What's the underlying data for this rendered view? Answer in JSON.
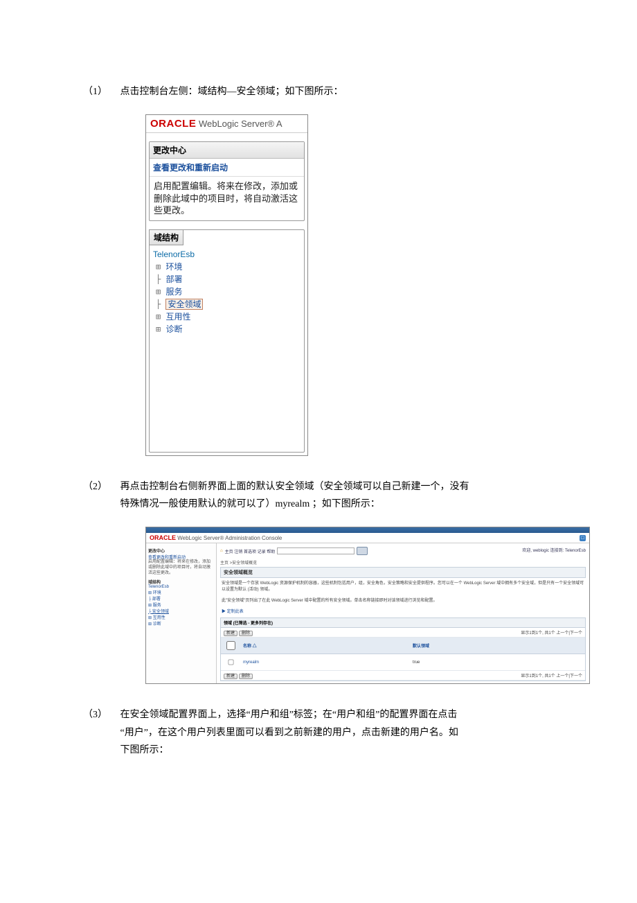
{
  "step1": {
    "num": "（1）",
    "text": "点击控制台左侧：域结构—安全领域；如下图所示："
  },
  "step2": {
    "num": "（2）",
    "line1": "再点击控制台右侧新界面上面的默认安全领域（安全领域可以自己新建一个，没有",
    "line2": "特殊情况一般使用默认的就可以了）myrealm ；如下图所示："
  },
  "step3": {
    "num": "（3）",
    "line1": "在安全领域配置界面上，选择“用户和组”标签；在“用户和组”的配置界面在点击",
    "line2": "“用户”，在这个用户列表里面可以看到之前新建的用户，点击新建的用户名。如",
    "line3": "下图所示："
  },
  "shot1": {
    "logo_oracle": "ORACLE",
    "logo_rest": " WebLogic Server® A",
    "change_center": "更改中心",
    "view_changes": "查看更改和重新启动",
    "config_edit_msg": "启用配置编辑。将来在修改，添加或删除此域中的项目时，将自动激活这些更改。",
    "domain_struct": "域结构",
    "tree": {
      "root": "TelenorEsb",
      "n1": "环境",
      "n2": "部署",
      "n3": "服务",
      "n4": "安全领域",
      "n5": "互用性",
      "n6": "诊断"
    }
  },
  "shot2": {
    "logo_oracle": "ORACLE",
    "logo_rest": " WebLogic Server® Administration Console",
    "side": {
      "change_center": "更改中心",
      "view_changes": "查看更改和重新启动",
      "config_msg": "启用配置编辑：将来在修改，添加或删除此域中的项目时，将自动激活这些更改。",
      "domain_struct": "域结构",
      "root": "TelenorEsb",
      "n1": "环境",
      "n2": "部署",
      "n3": "服务",
      "n4": "安全领域",
      "n5": "互用性",
      "n6": "诊断"
    },
    "crumbs_left": "主页 注销 首选项 记录 帮助",
    "crumbs_right": "欢迎, weblogic   连接到: TelenorEsb",
    "breadcrumb2": "主页 >安全领域概览",
    "panel_title": "安全领域概览",
    "desc1": "安全领域是一个存放 WebLogic 资源保护机制的容器，这些机制包括用户，组，安全角色，安全策略和安全提供程序。您可以在一个 WebLogic Server 域中拥有多个安全域，但是只有一个安全领域可以设置为默认 (活动) 领域。",
    "desc2": "此\"安全领域\"页列出了在此 WebLogic Server 域中配置的所有安全领域。单击名称链接即时对该领域进行浏览和配置。",
    "customize": "▶ 定制此表",
    "table": {
      "caption": "领域 (已筛选 - 更多列存在)",
      "btn_new": "新建",
      "btn_del": "删除",
      "pager": "显示1到1个, 共1个 上一个|下一个",
      "col_name": "名称 △",
      "col_default": "默认领域",
      "row_name": "myrealm",
      "row_default": "true"
    }
  }
}
